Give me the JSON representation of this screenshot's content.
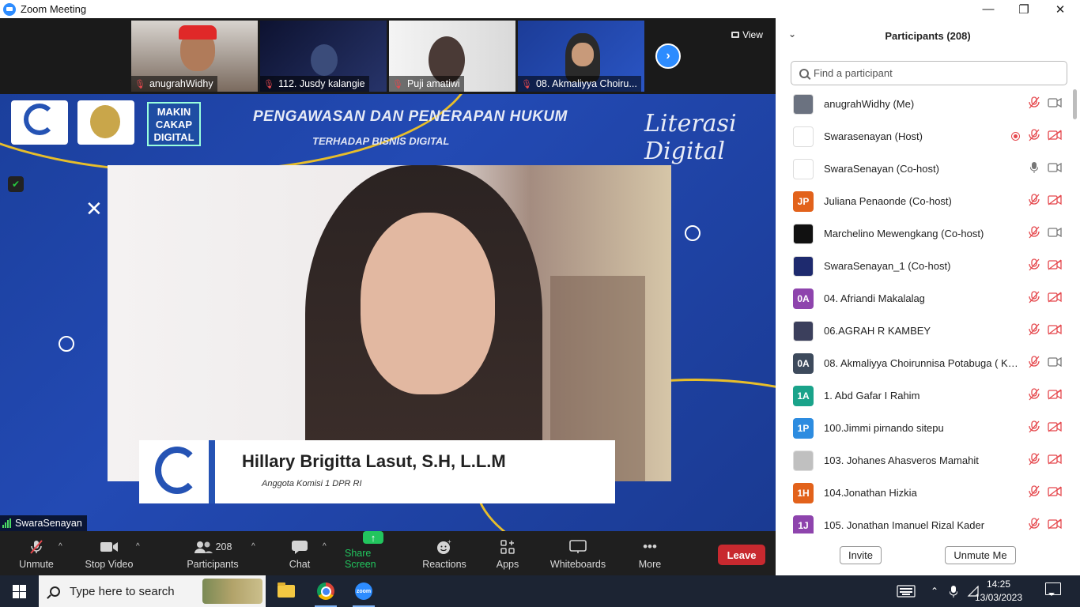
{
  "window": {
    "title": "Zoom Meeting",
    "minimize": "—",
    "restore": "❐",
    "close": "✕"
  },
  "gallery": {
    "thumbnails": [
      {
        "name": "anugrahWidhy"
      },
      {
        "name": "112. Jusdy kalangie"
      },
      {
        "name": "Puji amatiwi"
      },
      {
        "name": "08. Akmaliyya Choiru..."
      }
    ],
    "next_icon": "chevron-right-icon",
    "view_label": "View"
  },
  "stage": {
    "banner_title": "PENGAWASAN DAN PENERAPAN HUKUM",
    "banner_subtitle": "TERHADAP BISNIS DIGITAL",
    "literasi_text": "Literasi Digital",
    "logo_text_1": "MAKIN",
    "logo_text_2": "CAKAP",
    "logo_text_3": "DIGITAL",
    "speaker_name": "Hillary Brigitta Lasut, S.H, L.L.M",
    "speaker_role": "Anggota Komisi 1 DPR RI",
    "active_speaker": "SwaraSenayan"
  },
  "toolbar": {
    "unmute": "Unmute",
    "stop_video": "Stop Video",
    "participants": "Participants",
    "participants_count": "208",
    "chat": "Chat",
    "share_screen": "Share Screen",
    "reactions": "Reactions",
    "apps": "Apps",
    "whiteboards": "Whiteboards",
    "more": "More",
    "leave": "Leave",
    "accent_color": "#22c55e",
    "leave_color": "#c8292f"
  },
  "panel": {
    "title": "Participants (208)",
    "search_placeholder": "Find a participant",
    "participants": [
      {
        "name": "anugrahWidhy (Me)",
        "initials": "",
        "color": "#6b7280",
        "mic": "off",
        "video": "on",
        "photo": true
      },
      {
        "name": "Swarasenayan (Host)",
        "initials": "",
        "color": "#ffffff",
        "mic": "off",
        "video": "off",
        "rec": true,
        "photo": true
      },
      {
        "name": "SwaraSenayan (Co-host)",
        "initials": "",
        "color": "#ffffff",
        "mic": "on",
        "video": "on",
        "photo": true
      },
      {
        "name": "Juliana Penaonde (Co-host)",
        "initials": "JP",
        "color": "#e2621b",
        "mic": "off",
        "video": "off"
      },
      {
        "name": "Marchelino Mewengkang (Co-host)",
        "initials": "",
        "color": "#111111",
        "mic": "off",
        "video": "on",
        "photo": true
      },
      {
        "name": "SwaraSenayan_1 (Co-host)",
        "initials": "",
        "color": "#1e2a6e",
        "mic": "off",
        "video": "off",
        "photo": true
      },
      {
        "name": "04. Afriandi Makalalag",
        "initials": "0A",
        "color": "#8e44ad",
        "mic": "off",
        "video": "off"
      },
      {
        "name": "06.AGRAH R KAMBEY",
        "initials": "",
        "color": "#3b3f5c",
        "mic": "off",
        "video": "off",
        "photo": true
      },
      {
        "name": "08. Akmaliyya Choirunnisa Potabuga ( Kot...",
        "initials": "0A",
        "color": "#3d4a5c",
        "mic": "off",
        "video": "on"
      },
      {
        "name": "1. Abd Gafar I Rahim",
        "initials": "1A",
        "color": "#1aa38a",
        "mic": "off",
        "video": "off"
      },
      {
        "name": "100.Jimmi pirnando sitepu",
        "initials": "1P",
        "color": "#2d8ce0",
        "mic": "off",
        "video": "off"
      },
      {
        "name": "103. Johanes Ahasveros Mamahit",
        "initials": "",
        "color": "#c0c0c0",
        "mic": "off",
        "video": "off",
        "photo": true
      },
      {
        "name": "104.Jonathan Hizkia",
        "initials": "1H",
        "color": "#e2621b",
        "mic": "off",
        "video": "off"
      },
      {
        "name": "105. Jonathan Imanuel Rizal Kader",
        "initials": "1J",
        "color": "#8e44ad",
        "mic": "off",
        "video": "off"
      }
    ],
    "invite": "Invite",
    "unmute_me": "Unmute Me"
  },
  "taskbar": {
    "search_placeholder": "Type here to search",
    "apps": [
      "file-explorer-icon",
      "chrome-icon",
      "zoom-icon"
    ],
    "time": "14:25",
    "date": "13/03/2023"
  }
}
